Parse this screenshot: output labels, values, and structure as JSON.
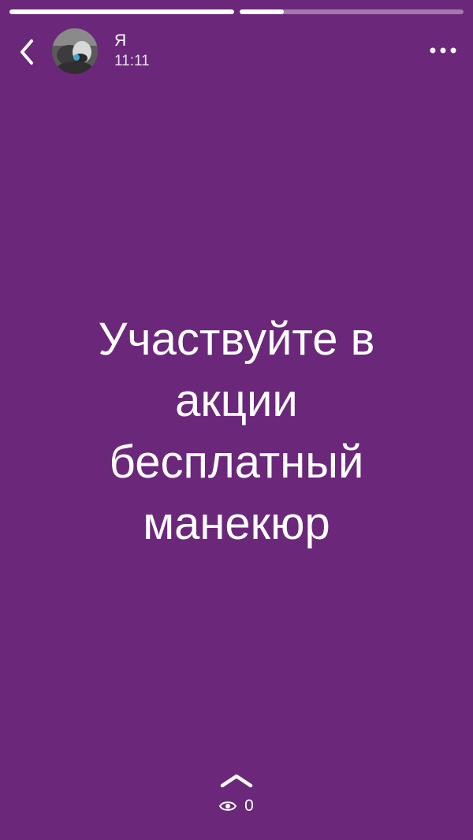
{
  "story": {
    "progress": [
      1.0,
      0.2
    ],
    "text": "Участвуйте в\nакции\nбесплатный\nманекюр",
    "background_color": "#6b277a"
  },
  "header": {
    "user_name": "Я",
    "time": "11:11",
    "back_icon": "chevron-left-icon",
    "more_icon": "more-dots-icon"
  },
  "footer": {
    "swipe_icon": "chevron-up-icon",
    "views_icon": "eye-icon",
    "views_count": "0"
  }
}
